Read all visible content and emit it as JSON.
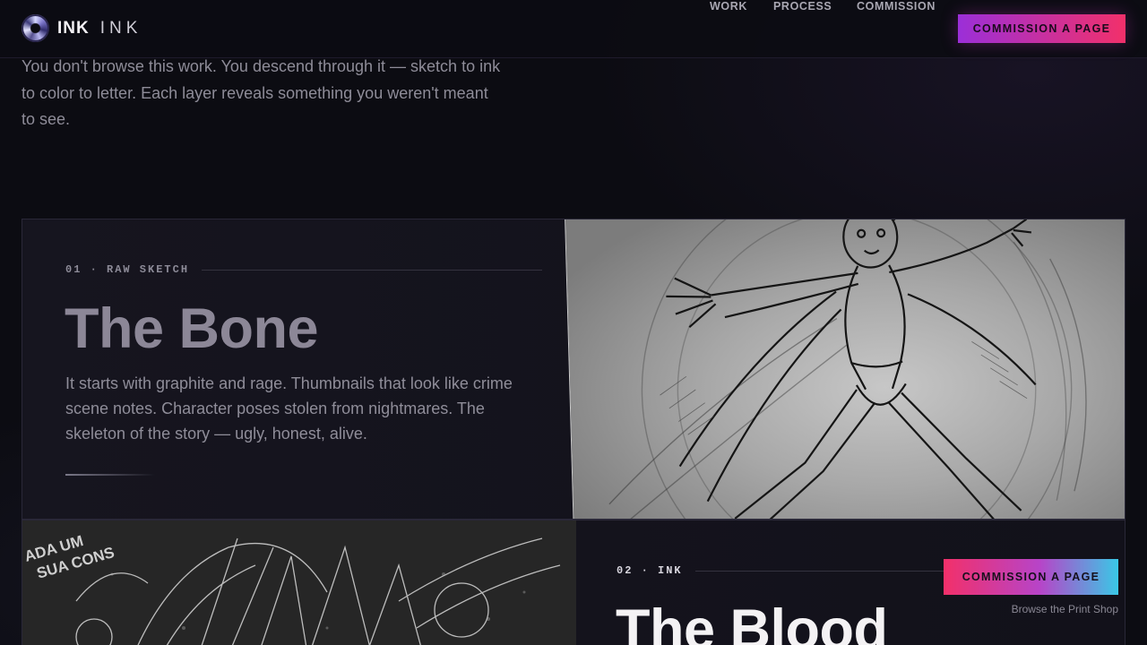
{
  "header": {
    "logo_bold": "INK",
    "logo_light": "INK",
    "nav": {
      "work": "WORK",
      "process": "PROCESS",
      "commission": "COMMISSION"
    },
    "cta": "COMMISSION A PAGE"
  },
  "intro": {
    "text": "You don't browse this work. You descend through it — sketch to ink to color to letter. Each layer reveals something you weren't meant to see."
  },
  "panels": [
    {
      "eyebrow": "01 · RAW SKETCH",
      "title": "The Bone",
      "body": "It starts with graphite and rage. Thumbnails that look like crime scene notes. Character poses stolen from nightmares. The skeleton of the story — ugly, honest, alive."
    },
    {
      "eyebrow": "02 · INK",
      "title": "The Blood",
      "art_text": [
        "ADA UM",
        "SUA CONS"
      ]
    }
  ],
  "floating": {
    "cta": "COMMISSION A PAGE",
    "link": "Browse the Print Shop"
  },
  "colors": {
    "background": "#0c0c12",
    "accent_magenta": "#f2306a",
    "accent_purple": "#9b2fd8",
    "accent_cyan": "#3ac8e6"
  },
  "icons": {
    "logo": "spiral-logo-icon"
  }
}
